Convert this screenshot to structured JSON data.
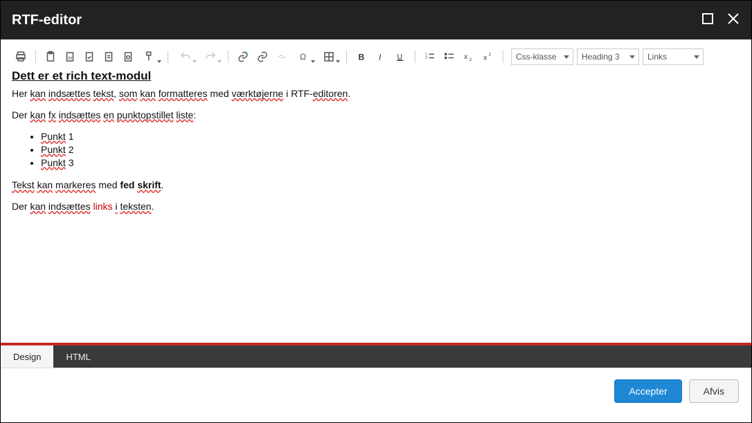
{
  "titlebar": {
    "title": "RTF-editor"
  },
  "toolbar": {
    "css_class_label": "Css-klasse",
    "heading_label": "Heading 3",
    "links_label": "Links"
  },
  "content": {
    "heading": "Dett er et rich text-modul",
    "p1_parts": {
      "a": "Her",
      "b": "kan",
      "c": "indsættes",
      "d": "tekst",
      "e": ",",
      "f": "som",
      "g": "kan",
      "h": "formatteres",
      "i": "med",
      "j": "værktøjerne",
      "k": "i RTF-",
      "l": "editoren",
      "m": "."
    },
    "p2_parts": {
      "a": "Der",
      "b": "kan",
      "c": "fx",
      "d": "indsættes",
      "e": "en",
      "f": "punktopstillet",
      "g": "liste",
      "h": ":"
    },
    "bullets": [
      {
        "w": "Punkt",
        "n": "1"
      },
      {
        "w": "Punkt",
        "n": "2"
      },
      {
        "w": "Punkt",
        "n": "3"
      }
    ],
    "p3_parts": {
      "a": "Tekst",
      "b": "kan",
      "c": "markeres",
      "d": "med",
      "e": "fed",
      "f": "skrift",
      "g": "."
    },
    "p4_parts": {
      "a": "Der",
      "b": "kan",
      "c": "indsættes",
      "d": "links",
      "e": "i",
      "f": "teksten",
      "g": "."
    }
  },
  "tabs": {
    "design": "Design",
    "html": "HTML"
  },
  "buttons": {
    "accept": "Accepter",
    "reject": "Afvis"
  }
}
